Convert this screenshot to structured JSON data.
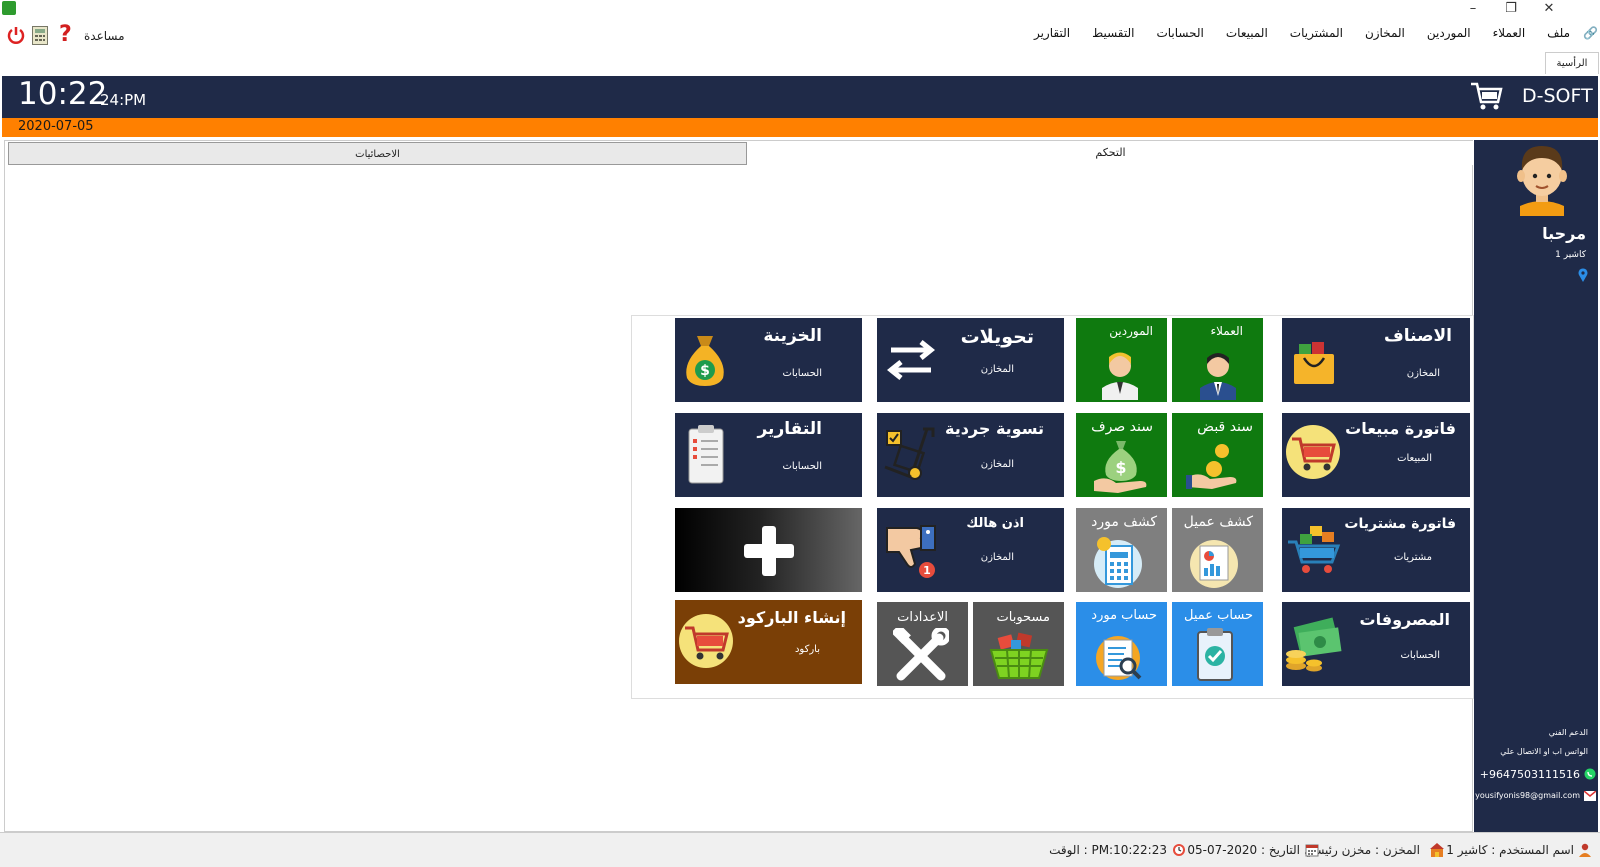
{
  "window": {
    "minimize": "–",
    "maximize": "❐",
    "close": "✕"
  },
  "toolbar": {
    "help_label": "مساعدة"
  },
  "menu": [
    "ملف",
    "العملاء",
    "الموردين",
    "المخازن",
    "المشتريات",
    "المبيعات",
    "الحسابات",
    "التقسيط",
    "التقارير"
  ],
  "tab_home": "الرأسية",
  "header": {
    "time": "10:22",
    "seconds_ampm": "24:PM",
    "brand": "D-SOFT",
    "date": "2020-07-05"
  },
  "tabs": {
    "stats": "الاحصائيات",
    "control": "التحكم"
  },
  "tiles": {
    "items": {
      "title": "الاصناف",
      "sub": "المخازن"
    },
    "customers": {
      "title": "العملاء"
    },
    "suppliers": {
      "title": "الموردين"
    },
    "transfers": {
      "title": "تحويلات",
      "sub": "المخازن"
    },
    "treasury": {
      "title": "الخزينة",
      "sub": "الحسابات"
    },
    "sales_invoice": {
      "title": "فاتورة مبيعات",
      "sub": "المبيعات"
    },
    "receipt": {
      "title": "سند قبض"
    },
    "payment": {
      "title": "سند صرف"
    },
    "inventory": {
      "title": "تسوية جردية",
      "sub": "المخازن"
    },
    "reports": {
      "title": "التقارير",
      "sub": "الحسابات"
    },
    "purchase_invoice": {
      "title": "فاتورة مشتريات",
      "sub": "مشتريات"
    },
    "customer_statement": {
      "title": "كشف عميل"
    },
    "supplier_statement": {
      "title": "كشف مورد"
    },
    "damage": {
      "title": "اذن هالك",
      "sub": "المخازن"
    },
    "expenses": {
      "title": "المصروفات",
      "sub": "الحسابات"
    },
    "customer_account": {
      "title": "حساب عميل"
    },
    "supplier_account": {
      "title": "حساب مورد"
    },
    "withdrawals": {
      "title": "مسحوبات"
    },
    "settings": {
      "title": "الاعدادات"
    },
    "barcode": {
      "title": "إنشاء الباركود",
      "sub": "باركود"
    }
  },
  "sidebar": {
    "welcome": "مرحبا",
    "user": "كاشير 1",
    "support_title": "الدعم الفني",
    "contact_line": "الواتس اب او الاتصال علي",
    "phone": "+9647503111516",
    "email": "yousifyonis98@gmail.com"
  },
  "status": {
    "user": "اسم المستخدم : كاشير 1",
    "store": "المخزن : مخزن رئيسي",
    "date": "التاريخ : 2020-07-05",
    "time": "الوقت : PM:10:22:23"
  },
  "colors": {
    "navy": "#1f2a48",
    "orange": "#ff8000",
    "green": "#0f7a0f",
    "blue": "#2b8ee8",
    "brown": "#7a3f06"
  }
}
